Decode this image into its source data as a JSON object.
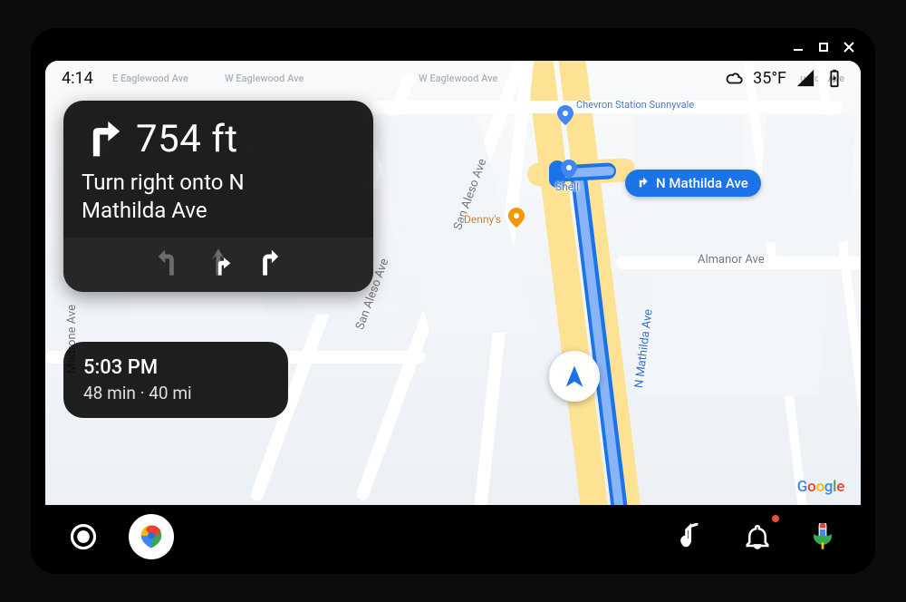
{
  "status_bar": {
    "time": "4:14",
    "temperature": "35°F"
  },
  "turn_card": {
    "distance": "754 ft",
    "instruction_line1": "Turn right onto N",
    "instruction_line2": "Mathilda Ave"
  },
  "trip_card": {
    "eta": "5:03 PM",
    "duration": "48 min",
    "distance": "40 mi",
    "separator": " · "
  },
  "map": {
    "street_sign": "N Mathilda Ave",
    "top_streets": {
      "e_eaglewood": "E Eaglewood Ave",
      "w_eaglewood": "W Eaglewood Ave",
      "w_eaglewood2": "W Eaglewood Ave",
      "ueros": "ueros Ave"
    },
    "road_labels": {
      "madrone": "Madrone Ave",
      "san_aleso": "San Aleso Ave",
      "san_aleso2": "San Aleso Ave",
      "almanor": "Almanor Ave",
      "n_mathilda": "N Mathilda Ave"
    },
    "pois": {
      "chevron": "Chevron Station Sunnyvale",
      "shell": "Shell",
      "dennys": "Denny's"
    },
    "watermark": {
      "g": "G",
      "o1": "o",
      "o2": "o",
      "g2": "g",
      "l": "l",
      "e": "e"
    }
  }
}
